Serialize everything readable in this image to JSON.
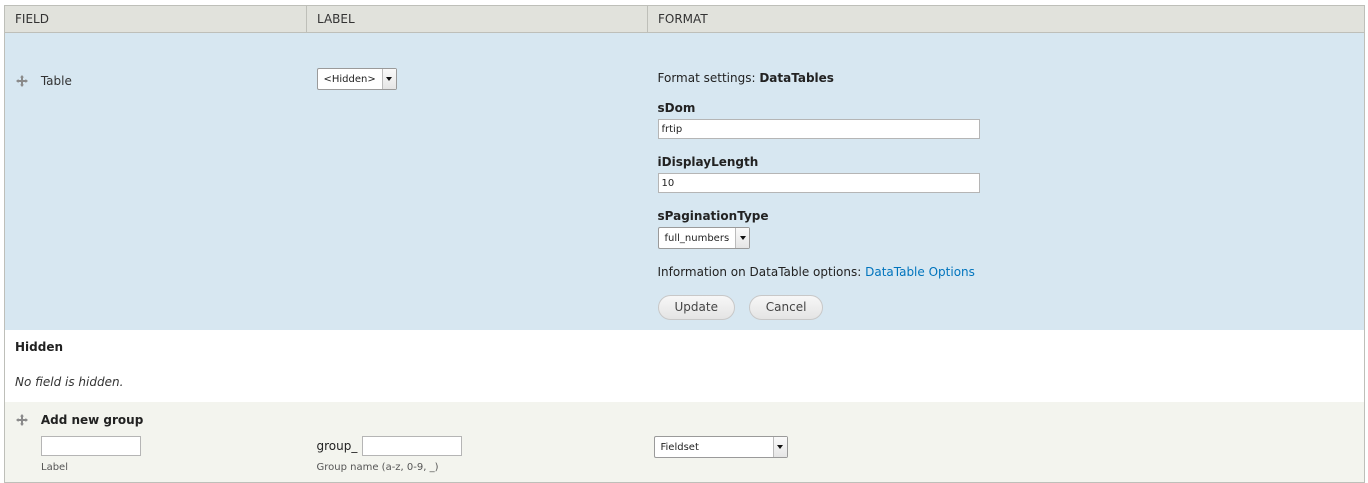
{
  "header": {
    "field": "Field",
    "label": "Label",
    "format": "Format"
  },
  "row_table": {
    "name": "Table",
    "label_select": "<Hidden>",
    "format_settings_prefix": "Format settings: ",
    "format_settings_value": "DataTables",
    "sdom_label": "sDom",
    "sdom_value": "frtip",
    "idisplaylength_label": "iDisplayLength",
    "idisplaylength_value": "10",
    "spagination_label": "sPaginationType",
    "spagination_value": "full_numbers",
    "info_prefix": "Information on DataTable options: ",
    "info_link": "DataTable Options",
    "update_button": "Update",
    "cancel_button": "Cancel"
  },
  "hidden_region": {
    "title": "Hidden",
    "message": "No field is hidden."
  },
  "add_group": {
    "title": "Add new group",
    "label_input_value": "",
    "label_desc": "Label",
    "group_prefix": "group_",
    "group_input_value": "",
    "group_desc": "Group name (a-z, 0-9, _)",
    "format_select": "Fieldset"
  },
  "icons": {
    "drag": "drag-handle-icon",
    "dropdown": "chevron-down-icon"
  },
  "colors": {
    "header_bg": "#e1e2dc",
    "editing_bg": "#d7e7f1",
    "add_group_bg": "#f3f4ee",
    "link": "#0074bd"
  }
}
